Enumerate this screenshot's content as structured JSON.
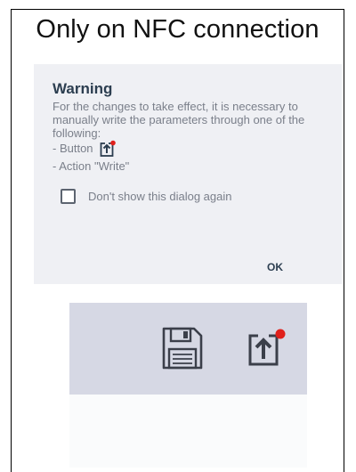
{
  "heading": "Only on NFC connection",
  "dialog": {
    "title": "Warning",
    "message": "For the changes to take effect, it is necessary to manually write the parameters through one of the following:",
    "option_button": "- Button",
    "option_action": "- Action \"Write\"",
    "checkbox_label": "Don't show this dialog again",
    "checkbox_checked": false,
    "ok_label": "OK"
  },
  "toolbar": {
    "icons": [
      "save-icon",
      "write-to-device-icon"
    ],
    "notification_dot_color": "#e0201b"
  },
  "colors": {
    "dialog_bg": "#eff0f4",
    "toolbar_bg": "#d6d8e4",
    "title_text": "#2c3e50",
    "body_text": "#7a7f8a"
  }
}
